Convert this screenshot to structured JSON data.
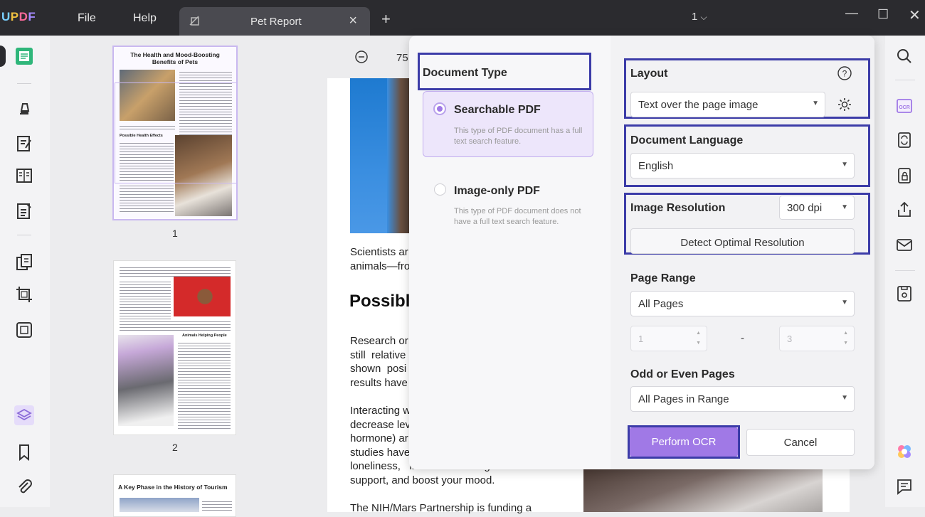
{
  "app": {
    "logo": {
      "u": "U",
      "p": "P",
      "d": "D",
      "f": "F"
    },
    "menu": {
      "file": "File",
      "help": "Help"
    },
    "tab_title": "Pet Report",
    "page_selector": "1"
  },
  "thumbnails": {
    "page1": {
      "title": "The Health and Mood-Boosting Benefits of Pets",
      "subheading": "Possible Health Effects",
      "number": "1"
    },
    "page2": {
      "subheading": "Animals Helping People",
      "number": "2"
    },
    "page3": {
      "title": "A Key Phase in the History of Tourism"
    }
  },
  "document": {
    "zoom_value": "75",
    "para1": "Scientists ar\nanimals—fro",
    "heading": "Possibl",
    "para2": "Research or\nstill  relative\nshown  posi\nresults have",
    "para3": "Interacting w\ndecrease lev\nhormone) ar\nstudies have\nloneliness,   increase   feelings   of   social\nsupport, and boost your mood.",
    "para4": "The NIH/Mars Partnership is funding a"
  },
  "ocr_dialog": {
    "document_type": {
      "label": "Document Type",
      "searchable": {
        "title": "Searchable PDF",
        "desc": "This type of PDF document has a full text search feature.",
        "selected": true
      },
      "image_only": {
        "title": "Image-only PDF",
        "desc": "This type of PDF document does not have a full text search feature.",
        "selected": false
      }
    },
    "layout": {
      "label": "Layout",
      "value": "Text over the page image"
    },
    "document_language": {
      "label": "Document Language",
      "value": "English"
    },
    "image_resolution": {
      "label": "Image Resolution",
      "value": "300 dpi",
      "detect_button": "Detect Optimal Resolution"
    },
    "page_range": {
      "label": "Page Range",
      "value": "All Pages",
      "from": "1",
      "separator": "-",
      "to": "3"
    },
    "odd_even": {
      "label": "Odd or Even Pages",
      "value": "All Pages in Range"
    },
    "perform_button": "Perform OCR",
    "cancel_button": "Cancel"
  },
  "colors": {
    "accent": "#a079e6",
    "highlight_box": "#3c3ca8",
    "titlebar": "#2b2b2f"
  }
}
